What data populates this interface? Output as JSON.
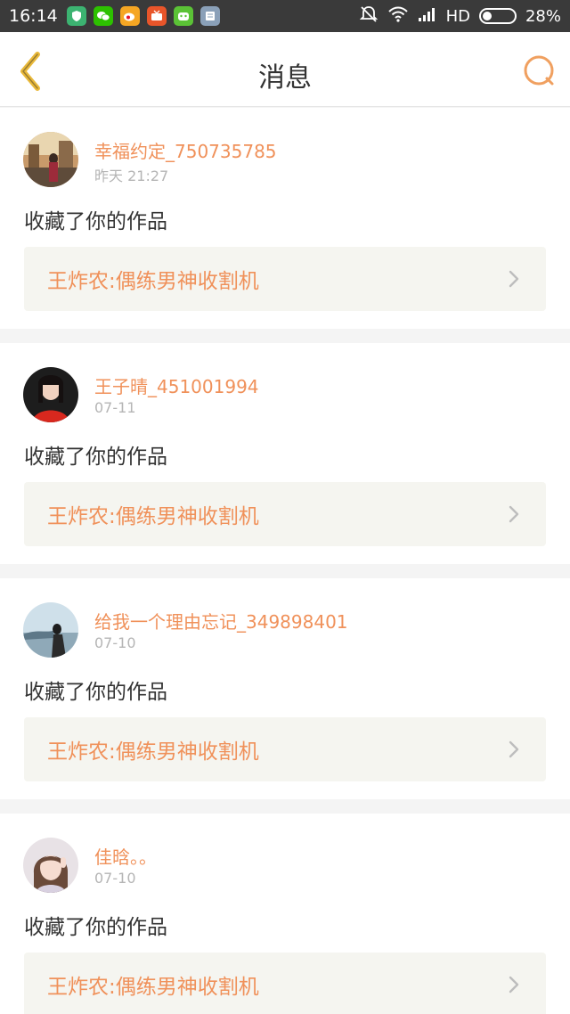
{
  "status_bar": {
    "time": "16:14",
    "network": "HD",
    "battery_percent": "28%",
    "battery_level": 0.28,
    "app_icons": [
      "shield-app-icon",
      "wechat-app-icon",
      "weibo-app-icon",
      "tv-app-icon",
      "robot-app-icon",
      "notes-app-icon"
    ]
  },
  "header": {
    "title": "消息",
    "accent_color": "#f0915a"
  },
  "messages": [
    {
      "username": "幸福约定_750735785",
      "time": "昨天 21:27",
      "action": "收藏了你的作品",
      "work_title": "王炸农:偶练男神收割机"
    },
    {
      "username": "王子晴_451001994",
      "time": "07-11",
      "action": "收藏了你的作品",
      "work_title": "王炸农:偶练男神收割机"
    },
    {
      "username": "给我一个理由忘记_349898401",
      "time": "07-10",
      "action": "收藏了你的作品",
      "work_title": "王炸农:偶练男神收割机"
    },
    {
      "username": "佳晗。。",
      "time": "07-10",
      "action": "收藏了你的作品",
      "work_title": "王炸农:偶练男神收割机"
    }
  ]
}
